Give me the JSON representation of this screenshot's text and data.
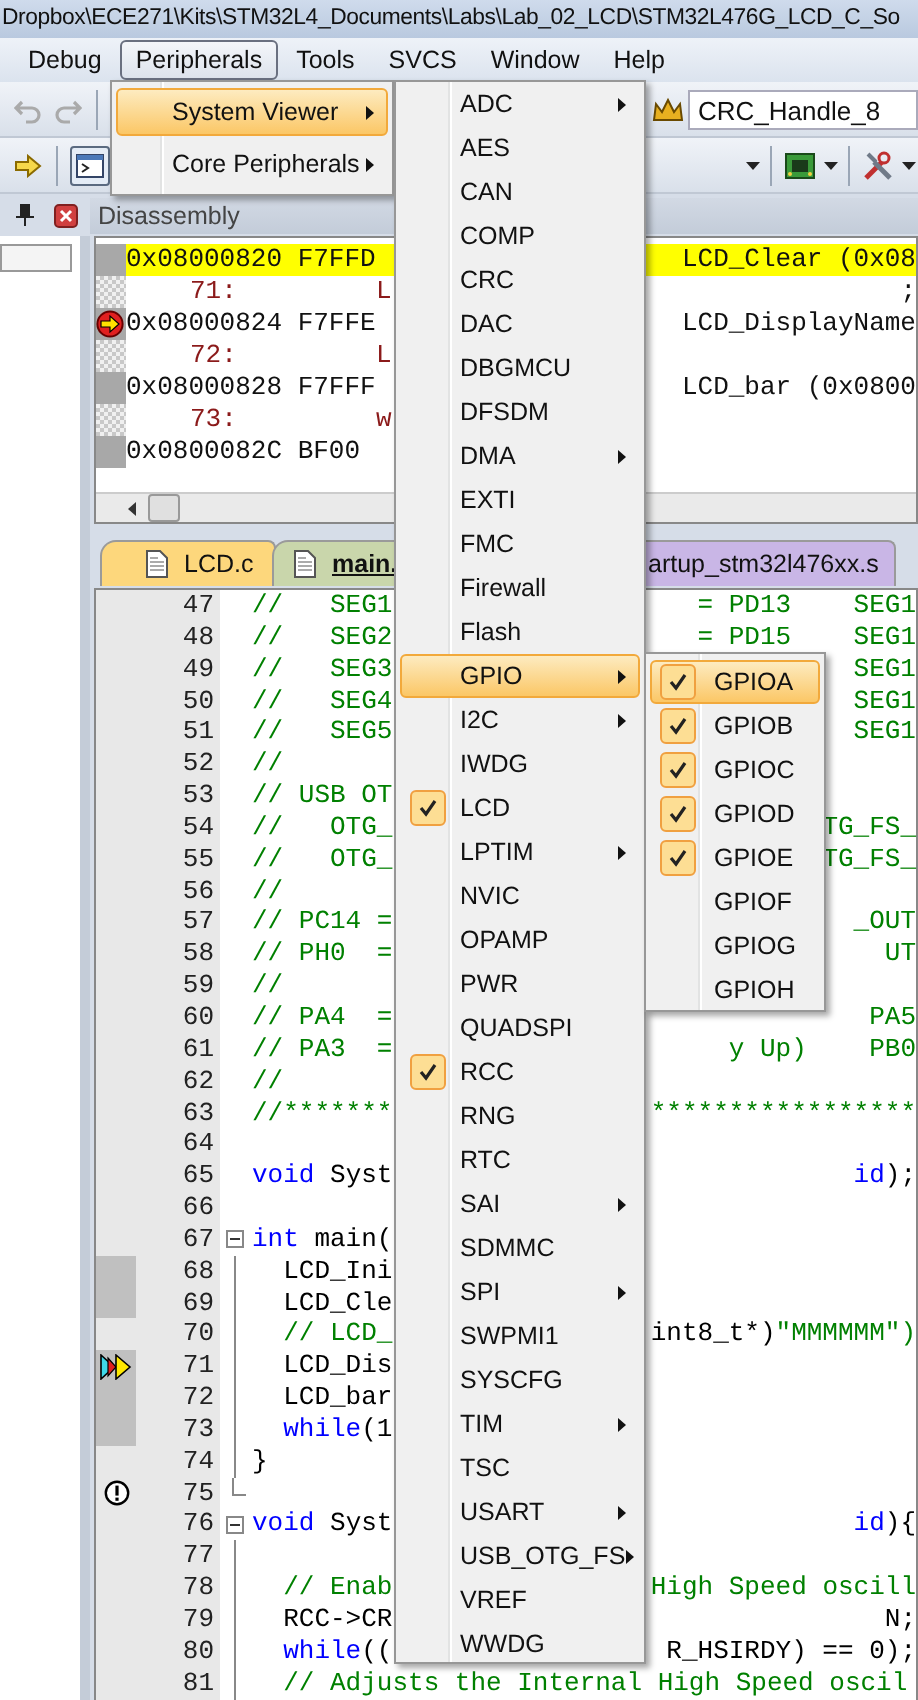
{
  "window": {
    "title": "Dropbox\\ECE271\\Kits\\STM32L4_Documents\\Labs\\Lab_02_LCD\\STM32L476G_LCD_C_So"
  },
  "menu_bar": [
    {
      "label": "Debug",
      "selected": false
    },
    {
      "label": "Peripherals",
      "selected": true
    },
    {
      "label": "Tools",
      "selected": false
    },
    {
      "label": "SVCS",
      "selected": false
    },
    {
      "label": "Window",
      "selected": false
    },
    {
      "label": "Help",
      "selected": false
    }
  ],
  "toolbar": {
    "combo_value": "CRC_Handle_8"
  },
  "disassembly": {
    "title": "Disassembly",
    "rows": [
      {
        "kind": "asm",
        "text": "0x08000820 F7FFD",
        "right": "LCD_Clear (0x08",
        "highlighted": true,
        "current": false
      },
      {
        "kind": "src",
        "number": "71:",
        "text": "L",
        "right": ";"
      },
      {
        "kind": "asm",
        "text": "0x08000824 F7FFE",
        "right": "LCD_DisplayName",
        "highlighted": false,
        "current": true
      },
      {
        "kind": "src",
        "number": "72:",
        "text": "L"
      },
      {
        "kind": "asm",
        "text": "0x08000828 F7FFF",
        "right": "LCD_bar (0x0800",
        "highlighted": false,
        "current": false
      },
      {
        "kind": "src",
        "number": "73:",
        "text": "w"
      },
      {
        "kind": "asm",
        "text": "0x0800082C BF00",
        "highlighted": false,
        "current": false
      }
    ]
  },
  "editor_tabs": [
    {
      "label": "LCD.c",
      "selected": false,
      "color": "#fdd77c"
    },
    {
      "label": "main.",
      "selected": true,
      "color": "#c9d6ab"
    },
    {
      "label": "artup_stm32l476xx.s",
      "selected": false,
      "color": "#c9b6e6"
    }
  ],
  "code_lines": [
    {
      "number": "47",
      "executed": false,
      "left": [
        {
          "kind": "comment",
          "text": "//   SEG1"
        }
      ],
      "right": [
        {
          "kind": "comment",
          "text": "= PD13    SEG1"
        }
      ]
    },
    {
      "number": "48",
      "executed": false,
      "left": [
        {
          "kind": "comment",
          "text": "//   SEG2"
        }
      ],
      "right": [
        {
          "kind": "comment",
          "text": "= PD15    SEG1"
        }
      ]
    },
    {
      "number": "49",
      "executed": false,
      "left": [
        {
          "kind": "comment",
          "text": "//   SEG3"
        }
      ],
      "right": [
        {
          "kind": "comment",
          "text": "SEG1"
        }
      ]
    },
    {
      "number": "50",
      "executed": false,
      "left": [
        {
          "kind": "comment",
          "text": "//   SEG4"
        }
      ],
      "right": [
        {
          "kind": "comment",
          "text": "SEG1"
        }
      ]
    },
    {
      "number": "51",
      "executed": false,
      "left": [
        {
          "kind": "comment",
          "text": "//   SEG5"
        }
      ],
      "right": [
        {
          "kind": "comment",
          "text": "SEG1"
        }
      ]
    },
    {
      "number": "52",
      "executed": false,
      "left": [
        {
          "kind": "comment",
          "text": "//"
        }
      ]
    },
    {
      "number": "53",
      "executed": false,
      "left": [
        {
          "kind": "comment",
          "text": "// USB OT"
        }
      ]
    },
    {
      "number": "54",
      "executed": false,
      "left": [
        {
          "kind": "comment",
          "text": "//   OTG_"
        }
      ],
      "right": [
        {
          "kind": "comment",
          "text": "TG_FS_"
        }
      ]
    },
    {
      "number": "55",
      "executed": false,
      "left": [
        {
          "kind": "comment",
          "text": "//   OTG_"
        }
      ],
      "right": [
        {
          "kind": "comment",
          "text": "TG_FS_"
        }
      ]
    },
    {
      "number": "56",
      "executed": false,
      "left": [
        {
          "kind": "comment",
          "text": "//"
        }
      ]
    },
    {
      "number": "57",
      "executed": false,
      "left": [
        {
          "kind": "comment",
          "text": "// PC14 ="
        }
      ],
      "right": [
        {
          "kind": "comment",
          "text": "_OUT"
        }
      ]
    },
    {
      "number": "58",
      "executed": false,
      "left": [
        {
          "kind": "comment",
          "text": "// PH0  ="
        }
      ],
      "right": [
        {
          "kind": "comment",
          "text": "UT"
        }
      ]
    },
    {
      "number": "59",
      "executed": false,
      "left": [
        {
          "kind": "comment",
          "text": "//"
        }
      ]
    },
    {
      "number": "60",
      "executed": false,
      "left": [
        {
          "kind": "comment",
          "text": "// PA4  ="
        }
      ],
      "right": [
        {
          "kind": "comment",
          "text": "PA5"
        }
      ]
    },
    {
      "number": "61",
      "executed": false,
      "left": [
        {
          "kind": "comment",
          "text": "// PA3  ="
        }
      ],
      "right": [
        {
          "kind": "comment",
          "text": "y Up)    PB0"
        }
      ]
    },
    {
      "number": "62",
      "executed": false,
      "left": [
        {
          "kind": "comment",
          "text": "//"
        }
      ]
    },
    {
      "number": "63",
      "executed": false,
      "left": [
        {
          "kind": "comment",
          "text": "//*******"
        }
      ],
      "right": [
        {
          "kind": "comment",
          "text": "*****************"
        }
      ]
    },
    {
      "number": "64",
      "executed": false
    },
    {
      "number": "65",
      "executed": false,
      "left": [
        {
          "kind": "keyword",
          "text": "void"
        },
        {
          "kind": "plain",
          "text": " Syst"
        }
      ],
      "right": [
        {
          "kind": "keyword",
          "text": "id"
        },
        {
          "kind": "plain",
          "text": ");"
        }
      ]
    },
    {
      "number": "66",
      "executed": false
    },
    {
      "number": "67",
      "executed": false,
      "fold_start": true,
      "left": [
        {
          "kind": "keyword",
          "text": "int"
        },
        {
          "kind": "plain",
          "text": " main("
        }
      ]
    },
    {
      "number": "68",
      "executed": true,
      "fold_line": true,
      "left": [
        {
          "kind": "plain",
          "text": "  LCD_Ini"
        }
      ]
    },
    {
      "number": "69",
      "executed": true,
      "fold_line": true,
      "left": [
        {
          "kind": "plain",
          "text": "  LCD_Cle"
        }
      ]
    },
    {
      "number": "70",
      "executed": false,
      "fold_line": true,
      "left": [
        {
          "kind": "comment",
          "text": "  // LCD_"
        }
      ],
      "right": [
        {
          "kind": "plain",
          "text": "int8_t*)"
        },
        {
          "kind": "comment",
          "text": "\"MMMMMM\")"
        }
      ]
    },
    {
      "number": "71",
      "executed": true,
      "fold_line": true,
      "current": true,
      "left": [
        {
          "kind": "plain",
          "text": "  LCD_Dis"
        }
      ]
    },
    {
      "number": "72",
      "executed": true,
      "fold_line": true,
      "left": [
        {
          "kind": "plain",
          "text": "  LCD_bar"
        }
      ]
    },
    {
      "number": "73",
      "executed": true,
      "fold_line": true,
      "left": [
        {
          "kind": "keyword",
          "text": "  while"
        },
        {
          "kind": "plain",
          "text": "(1"
        }
      ]
    },
    {
      "number": "74",
      "executed": false,
      "fold_line": true,
      "left": [
        {
          "kind": "plain",
          "text": "}"
        }
      ]
    },
    {
      "number": "75",
      "executed": false,
      "fold_end": true,
      "warning": true
    },
    {
      "number": "76",
      "executed": false,
      "fold_start": true,
      "left": [
        {
          "kind": "keyword",
          "text": "void"
        },
        {
          "kind": "plain",
          "text": " Syst"
        }
      ],
      "right": [
        {
          "kind": "keyword",
          "text": "id"
        },
        {
          "kind": "plain",
          "text": "){"
        }
      ]
    },
    {
      "number": "77",
      "executed": false,
      "fold_line": true
    },
    {
      "number": "78",
      "executed": false,
      "fold_line": true,
      "left": [
        {
          "kind": "comment",
          "text": "  // Enab"
        }
      ],
      "right": [
        {
          "kind": "comment",
          "text": "High Speed oscill"
        }
      ]
    },
    {
      "number": "79",
      "executed": false,
      "fold_line": true,
      "left": [
        {
          "kind": "plain",
          "text": "  RCC->CR"
        }
      ],
      "right": [
        {
          "kind": "plain",
          "text": "N;"
        }
      ]
    },
    {
      "number": "80",
      "executed": false,
      "fold_line": true,
      "left": [
        {
          "kind": "keyword",
          "text": "  while"
        },
        {
          "kind": "plain",
          "text": "(("
        }
      ],
      "right": [
        {
          "kind": "plain",
          "text": "R_HSIRDY) == 0);"
        }
      ]
    },
    {
      "number": "81",
      "executed": false,
      "fold_line": true,
      "left": [
        {
          "kind": "comment",
          "text": "  // Adjusts the Internal High Speed oscil"
        }
      ]
    }
  ],
  "peripherals_menu": [
    {
      "label": "System Viewer",
      "selected": true,
      "submenu": true
    },
    {
      "label": "Core Peripherals",
      "selected": false,
      "submenu": true
    }
  ],
  "system_viewer_menu": [
    {
      "label": "ADC",
      "selected": false,
      "checked": false,
      "submenu": true
    },
    {
      "label": "AES",
      "selected": false,
      "checked": false,
      "submenu": false
    },
    {
      "label": "CAN",
      "selected": false,
      "checked": false,
      "submenu": false
    },
    {
      "label": "COMP",
      "selected": false,
      "checked": false,
      "submenu": false
    },
    {
      "label": "CRC",
      "selected": false,
      "checked": false,
      "submenu": false
    },
    {
      "label": "DAC",
      "selected": false,
      "checked": false,
      "submenu": false
    },
    {
      "label": "DBGMCU",
      "selected": false,
      "checked": false,
      "submenu": false
    },
    {
      "label": "DFSDM",
      "selected": false,
      "checked": false,
      "submenu": false
    },
    {
      "label": "DMA",
      "selected": false,
      "checked": false,
      "submenu": true
    },
    {
      "label": "EXTI",
      "selected": false,
      "checked": false,
      "submenu": false
    },
    {
      "label": "FMC",
      "selected": false,
      "checked": false,
      "submenu": false
    },
    {
      "label": "Firewall",
      "selected": false,
      "checked": false,
      "submenu": false
    },
    {
      "label": "Flash",
      "selected": false,
      "checked": false,
      "submenu": false
    },
    {
      "label": "GPIO",
      "selected": true,
      "checked": false,
      "submenu": true
    },
    {
      "label": "I2C",
      "selected": false,
      "checked": false,
      "submenu": true
    },
    {
      "label": "IWDG",
      "selected": false,
      "checked": false,
      "submenu": false
    },
    {
      "label": "LCD",
      "selected": false,
      "checked": true,
      "submenu": false
    },
    {
      "label": "LPTIM",
      "selected": false,
      "checked": false,
      "submenu": true
    },
    {
      "label": "NVIC",
      "selected": false,
      "checked": false,
      "submenu": false
    },
    {
      "label": "OPAMP",
      "selected": false,
      "checked": false,
      "submenu": false
    },
    {
      "label": "PWR",
      "selected": false,
      "checked": false,
      "submenu": false
    },
    {
      "label": "QUADSPI",
      "selected": false,
      "checked": false,
      "submenu": false
    },
    {
      "label": "RCC",
      "selected": false,
      "checked": true,
      "submenu": false
    },
    {
      "label": "RNG",
      "selected": false,
      "checked": false,
      "submenu": false
    },
    {
      "label": "RTC",
      "selected": false,
      "checked": false,
      "submenu": false
    },
    {
      "label": "SAI",
      "selected": false,
      "checked": false,
      "submenu": true
    },
    {
      "label": "SDMMC",
      "selected": false,
      "checked": false,
      "submenu": false
    },
    {
      "label": "SPI",
      "selected": false,
      "checked": false,
      "submenu": true
    },
    {
      "label": "SWPMI1",
      "selected": false,
      "checked": false,
      "submenu": false
    },
    {
      "label": "SYSCFG",
      "selected": false,
      "checked": false,
      "submenu": false
    },
    {
      "label": "TIM",
      "selected": false,
      "checked": false,
      "submenu": true
    },
    {
      "label": "TSC",
      "selected": false,
      "checked": false,
      "submenu": false
    },
    {
      "label": "USART",
      "selected": false,
      "checked": false,
      "submenu": true
    },
    {
      "label": "USB_OTG_FS",
      "selected": false,
      "checked": false,
      "submenu": true
    },
    {
      "label": "VREF",
      "selected": false,
      "checked": false,
      "submenu": false
    },
    {
      "label": "WWDG",
      "selected": false,
      "checked": false,
      "submenu": false
    }
  ],
  "gpio_menu": [
    {
      "label": "GPIOA",
      "selected": true,
      "checked": true
    },
    {
      "label": "GPIOB",
      "selected": false,
      "checked": true
    },
    {
      "label": "GPIOC",
      "selected": false,
      "checked": true
    },
    {
      "label": "GPIOD",
      "selected": false,
      "checked": true
    },
    {
      "label": "GPIOE",
      "selected": false,
      "checked": true
    },
    {
      "label": "GPIOF",
      "selected": false,
      "checked": false
    },
    {
      "label": "GPIOG",
      "selected": false,
      "checked": false
    },
    {
      "label": "GPIOH",
      "selected": false,
      "checked": false
    }
  ]
}
